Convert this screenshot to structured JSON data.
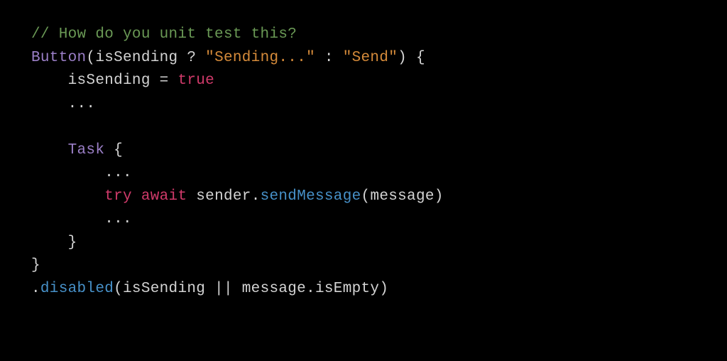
{
  "code": {
    "line1": {
      "comment": "// How do you unit test this?"
    },
    "line2": {
      "button": "Button",
      "lparen": "(",
      "cond": "isSending",
      "qmark": " ? ",
      "str1": "\"Sending...\"",
      "colon": " : ",
      "str2": "\"Send\"",
      "rparen_brace": ") {"
    },
    "line3": {
      "indent": "    ",
      "assign": "isSending = ",
      "true": "true"
    },
    "line4": {
      "indent": "    ",
      "dots": "..."
    },
    "line5": {
      "blank": ""
    },
    "line6": {
      "indent": "    ",
      "task": "Task",
      "brace": " {"
    },
    "line7": {
      "indent": "        ",
      "dots": "..."
    },
    "line8": {
      "indent": "        ",
      "try": "try",
      "sp1": " ",
      "await": "await",
      "sp2": " ",
      "sender": "sender",
      "dot": ".",
      "sendMessage": "sendMessage",
      "lparen": "(",
      "message": "message",
      "rparen": ")"
    },
    "line9": {
      "indent": "        ",
      "dots": "..."
    },
    "line10": {
      "indent": "    ",
      "close": "}"
    },
    "line11": {
      "close": "}"
    },
    "line12": {
      "dot": ".",
      "disabled": "disabled",
      "lparen": "(",
      "cond1": "isSending",
      "or": " || ",
      "msg": "message",
      "dot2": ".",
      "isEmpty": "isEmpty",
      "rparen": ")"
    }
  }
}
